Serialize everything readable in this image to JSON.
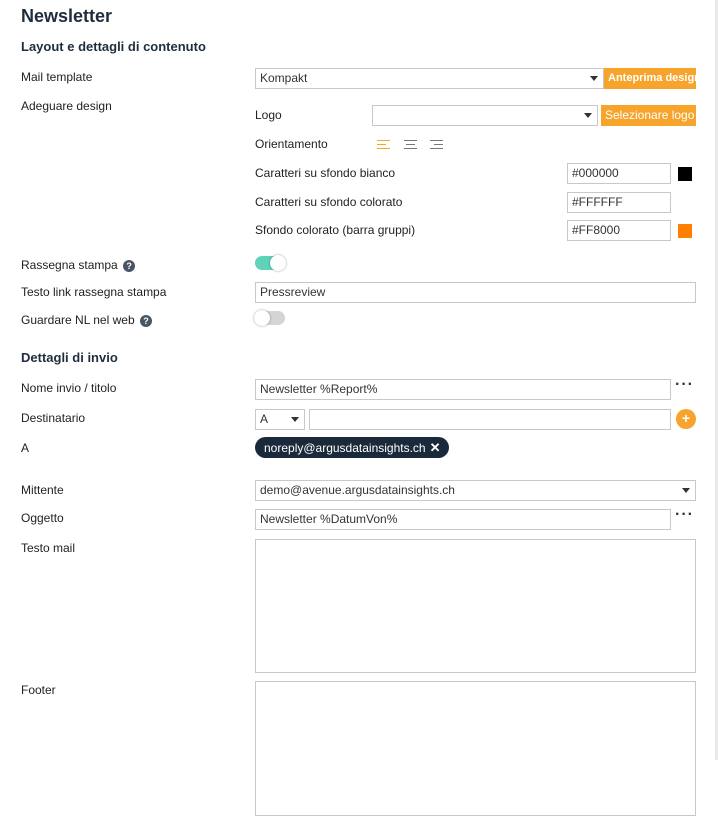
{
  "page": {
    "title": "Newsletter"
  },
  "layout_section": {
    "heading": "Layout e dettagli di contenuto",
    "mail_template": {
      "label": "Mail template",
      "value": "Kompakt",
      "preview_button": "Anteprima design"
    },
    "adjust_design": {
      "label": "Adeguare design",
      "logo": {
        "label": "Logo",
        "value": "",
        "button": "Selezionare logo"
      },
      "orientation": {
        "label": "Orientamento",
        "options": [
          "left",
          "center",
          "right"
        ],
        "selected": "left"
      },
      "text_on_white": {
        "label": "Caratteri su sfondo bianco",
        "value": "#000000",
        "color": "#000000"
      },
      "text_on_colored": {
        "label": "Caratteri su sfondo colorato",
        "value": "#FFFFFF",
        "color": "#FFFFFF"
      },
      "colored_background": {
        "label": "Sfondo colorato (barra gruppi)",
        "value": "#FF8000",
        "color": "#FF8000"
      }
    },
    "press_review": {
      "label": "Rassegna stampa",
      "help": "?",
      "enabled": true
    },
    "press_review_link_text": {
      "label": "Testo link rassegna stampa",
      "value": "Pressreview"
    },
    "view_in_web": {
      "label": "Guardare NL nel web",
      "help": "?",
      "enabled": false
    }
  },
  "send_section": {
    "heading": "Dettagli di invio",
    "send_name": {
      "label": "Nome invio / titolo",
      "value": "Newsletter %Report%",
      "more": "···"
    },
    "recipient": {
      "label": "Destinatario",
      "type_value": "A",
      "input_value": "",
      "add": "+"
    },
    "to": {
      "label": "A",
      "chips": [
        {
          "email": "noreply@argusdatainsights.ch",
          "remove": "✕"
        }
      ]
    },
    "sender": {
      "label": "Mittente",
      "value": "demo@avenue.argusdatainsights.ch"
    },
    "subject": {
      "label": "Oggetto",
      "value": "Newsletter %DatumVon%",
      "more": "···"
    },
    "mail_text": {
      "label": "Testo mail",
      "value": ""
    },
    "footer": {
      "label": "Footer",
      "value": ""
    }
  },
  "colors": {
    "accent_orange": "#f6a42b",
    "toggle_on": "#5fd3b8",
    "chip_bg": "#1b2a3b"
  }
}
